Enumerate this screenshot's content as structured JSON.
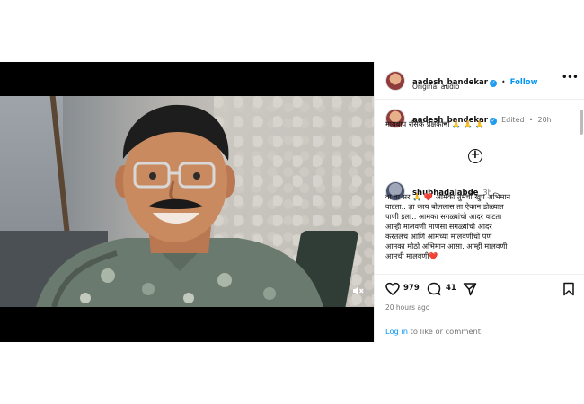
{
  "post": {
    "username": "aadesh_bandekar",
    "follow_label": "Follow",
    "dot_sep": "•",
    "audio": "Original audio",
    "caption": "मायबाप रसिक प्रेक्षकाना 🙏 🙏 🙏",
    "caption_edited": "Edited",
    "caption_time": "20h"
  },
  "comment": {
    "username": "shubhadalabde",
    "time": "3h",
    "text_lines": [
      "वा वा सर 🙏 ❤️ आमका तुमचो खुप अभिमान",
      "वाटता.. ज्ञा काय बोललास ता ऐकान डोळ्यात",
      "पाणी इला.. आमका सगळ्यांचो आदर वाटता",
      "आम्ही मालवणी माणसा सगळ्यांचो आदर",
      "करतलच आणि आमच्या मालवणीचो पण",
      "आमका मोठो अभिमान आसा. आम्ही मालवणी",
      "आमची मालवणी❤️"
    ]
  },
  "stats": {
    "likes": "979",
    "comments": "41"
  },
  "time_ago": "20 hours ago",
  "login": {
    "link": "Log in",
    "rest": " to like or comment."
  },
  "colors": {
    "accent": "#0095f6",
    "verified": "#1f9bf0",
    "muted_text": "#737373"
  },
  "icons": {
    "like": "heart-icon",
    "comment": "comment-bubble-icon",
    "share": "paper-plane-icon",
    "save": "bookmark-icon",
    "more": "more-options-icon",
    "add": "plus-circle-icon",
    "mute": "muted-speaker-icon"
  }
}
